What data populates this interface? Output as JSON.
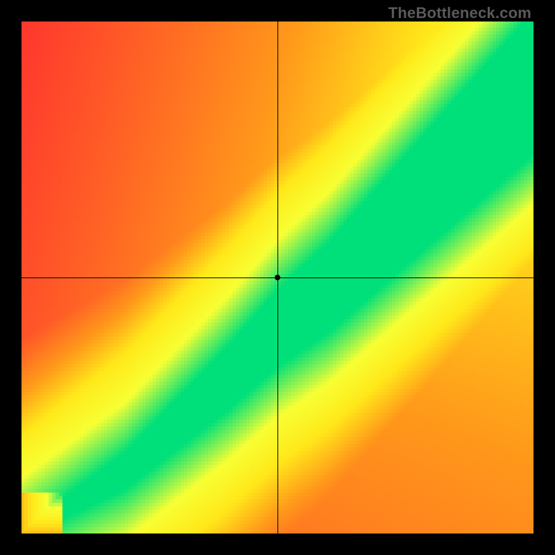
{
  "watermark": "TheBottleneck.com",
  "chart_data": {
    "type": "heatmap",
    "title": "",
    "xlabel": "",
    "ylabel": "",
    "xlim": [
      0,
      100
    ],
    "ylim": [
      0,
      100
    ],
    "crosshair": {
      "x": 50,
      "y": 50
    },
    "marker": {
      "x": 50,
      "y": 50
    },
    "color_scale": [
      {
        "value": 0.0,
        "color": "#ff1a33"
      },
      {
        "value": 0.45,
        "color": "#ff9a1a"
      },
      {
        "value": 0.65,
        "color": "#ffe81a"
      },
      {
        "value": 0.82,
        "color": "#f7ff33"
      },
      {
        "value": 1.0,
        "color": "#00e07a"
      }
    ],
    "ridge": {
      "description": "Approximate green optimal band (diagonal ridge)",
      "points": [
        {
          "x": 0,
          "y": 0
        },
        {
          "x": 20,
          "y": 12
        },
        {
          "x": 40,
          "y": 30
        },
        {
          "x": 50,
          "y": 40
        },
        {
          "x": 60,
          "y": 48
        },
        {
          "x": 80,
          "y": 68
        },
        {
          "x": 100,
          "y": 88
        }
      ],
      "band_width_start": 1,
      "band_width_end": 14
    },
    "grid": false,
    "legend": false
  },
  "layout": {
    "plot_left": 30,
    "plot_top": 30,
    "plot_size": 740,
    "heatmap_resolution": 148
  },
  "colors": {
    "background": "#000000",
    "crosshair": "#000000",
    "marker": "#000000",
    "watermark": "#5a5a5a"
  }
}
